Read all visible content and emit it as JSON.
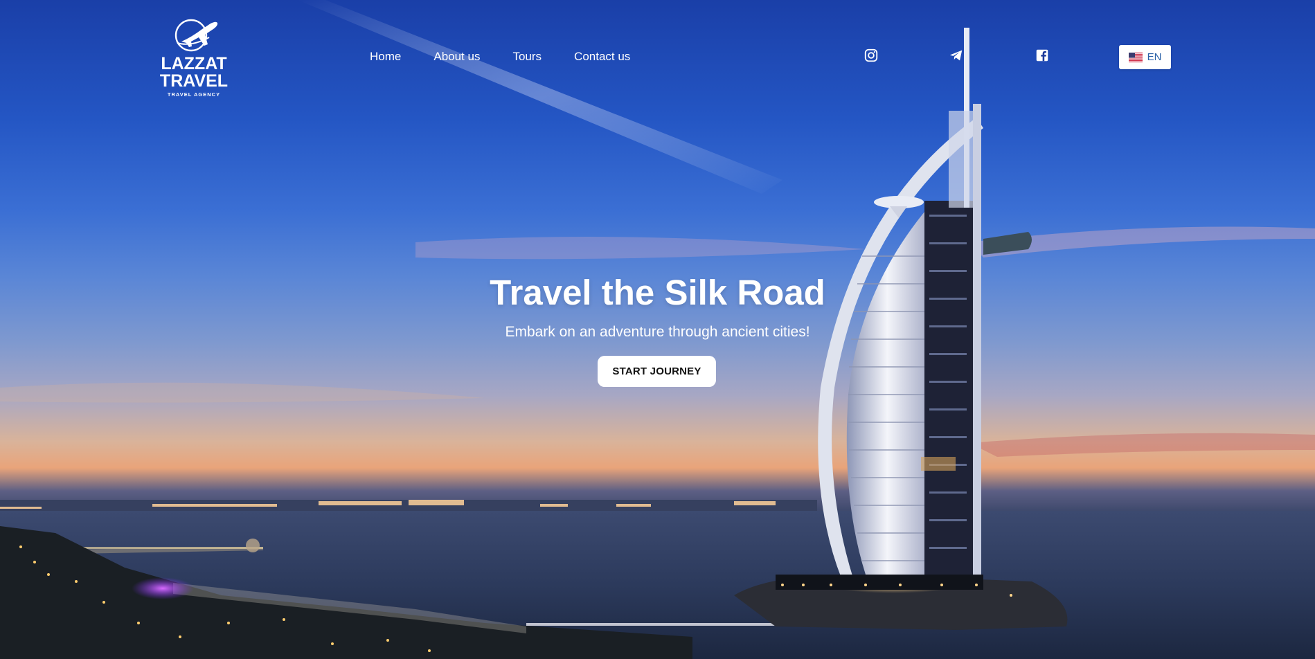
{
  "brand": {
    "line1": "LAZZAT",
    "line2": "TRAVEL",
    "tagline": "TRAVEL AGENCY"
  },
  "nav": {
    "items": [
      {
        "label": "Home"
      },
      {
        "label": "About us"
      },
      {
        "label": "Tours"
      },
      {
        "label": "Contact us"
      }
    ]
  },
  "social": {
    "icons": [
      "instagram-icon",
      "telegram-icon",
      "facebook-icon"
    ]
  },
  "language": {
    "code": "EN",
    "flag": "us-flag-icon"
  },
  "hero": {
    "title": "Travel the Silk Road",
    "subtitle": "Embark on an adventure through ancient cities!",
    "cta_label": "START JOURNEY"
  },
  "colors": {
    "text_on_hero": "#ffffff",
    "button_bg": "#ffffff",
    "button_text": "#111111",
    "lang_text": "#2b62a8",
    "sky_top": "#1a3fa8",
    "sunset": "#e9a47a"
  }
}
